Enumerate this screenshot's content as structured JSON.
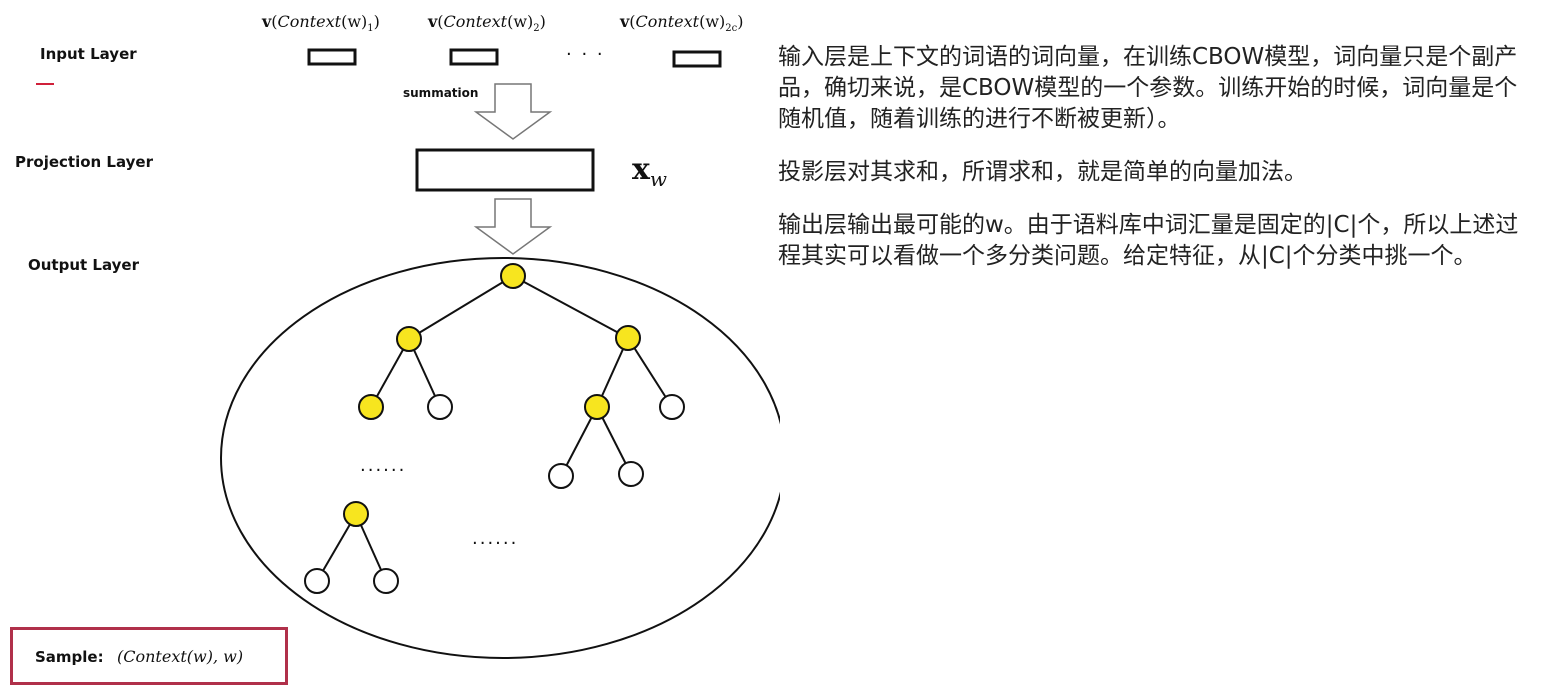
{
  "diagram": {
    "input_layer_label": "Input Layer",
    "projection_layer_label": "Projection Layer",
    "output_layer_label": "Output Layer",
    "summation_label": "summation",
    "context_vectors": [
      {
        "prefix": "v",
        "name": "Context",
        "arg": "(w)",
        "sub": "1",
        "close": ")"
      },
      {
        "prefix": "v",
        "name": "Context",
        "arg": "(w)",
        "sub": "2",
        "close": ")"
      },
      {
        "prefix": "v",
        "name": "Context",
        "arg": "(w)",
        "sub": "2c",
        "close": ")"
      }
    ],
    "input_ellipsis": "· · ·",
    "projection_symbol": "x",
    "projection_subscript": "w",
    "tree_ellipsis_left": "......",
    "tree_ellipsis_right": "......",
    "colors": {
      "inner_node": "#f7e51f",
      "leaf_node": "#ffffff",
      "stroke": "#111111",
      "sample_border": "#b0304a",
      "accent_dash": "#d0203a"
    }
  },
  "sample": {
    "label": "Sample:",
    "formula": "(Context(w), w)"
  },
  "description": {
    "paragraphs": [
      "输入层是上下文的词语的词向量，在训练CBOW模型，词向量只是个副产品，确切来说，是CBOW模型的一个参数。训练开始的时候，词向量是个随机值，随着训练的进行不断被更新）。",
      "投影层对其求和，所谓求和，就是简单的向量加法。",
      "输出层输出最可能的w。由于语料库中词汇量是固定的|C|个，所以上述过程其实可以看做一个多分类问题。给定特征，从|C|个分类中挑一个。"
    ]
  }
}
